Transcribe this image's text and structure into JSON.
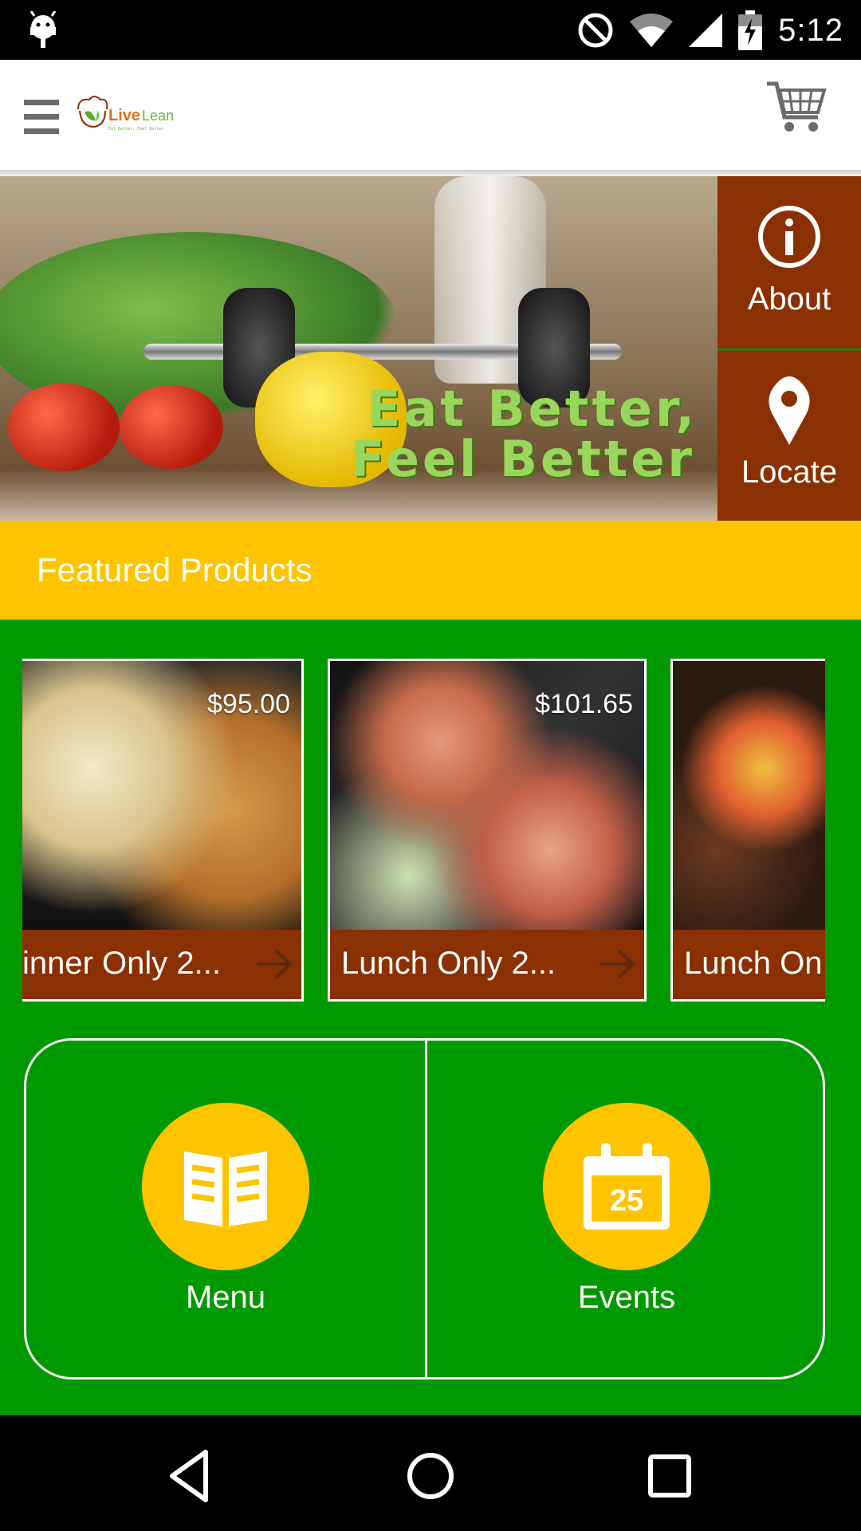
{
  "status_bar": {
    "time": "5:12"
  },
  "app_bar": {
    "logo_text": "LiveLean",
    "logo_tagline": "Eat Better, Feel Better"
  },
  "hero": {
    "tagline_line1": "Eat Better,",
    "tagline_line2": "Feel Better"
  },
  "side_menu": {
    "about_label": "About",
    "locate_label": "Locate"
  },
  "featured": {
    "title": "Featured Products",
    "products": [
      {
        "name": "inner Only 2...",
        "price": "$95.00"
      },
      {
        "name": "Lunch Only 2...",
        "price": "$101.65"
      },
      {
        "name": "Lunch On",
        "price": ""
      }
    ]
  },
  "quick_links": {
    "menu_label": "Menu",
    "events_label": "Events",
    "calendar_day": "25"
  },
  "colors": {
    "brown": "#8a3002",
    "yellow": "#ffc400",
    "green": "#009900"
  }
}
